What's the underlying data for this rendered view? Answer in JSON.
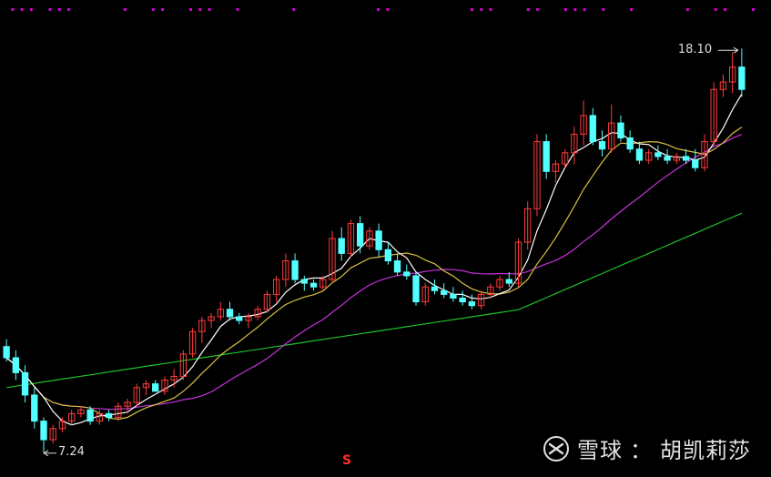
{
  "chart_data": {
    "type": "candlestick",
    "price_range": [
      6.6,
      19.4
    ],
    "high_label": "18.10",
    "low_label": "7.24",
    "signal_mark": "S",
    "colors": {
      "up": "#ff3b3b",
      "down": "#54ffff",
      "ma5": "#ffffff",
      "ma10": "#d6c242",
      "ma20": "#c433d8",
      "ma60": "#1fbf2a",
      "marker": "#d400d4",
      "grid": "#2a0000"
    },
    "candles": [
      [
        10.1,
        10.3,
        9.7,
        9.8
      ],
      [
        9.8,
        10.0,
        9.2,
        9.4
      ],
      [
        9.4,
        9.6,
        8.6,
        8.8
      ],
      [
        8.8,
        9.0,
        7.9,
        8.1
      ],
      [
        8.1,
        8.2,
        7.24,
        7.6
      ],
      [
        7.6,
        8.0,
        7.5,
        7.9
      ],
      [
        7.9,
        8.2,
        7.8,
        8.1
      ],
      [
        8.1,
        8.4,
        8.0,
        8.3
      ],
      [
        8.3,
        8.5,
        8.2,
        8.4
      ],
      [
        8.4,
        8.5,
        8.0,
        8.1
      ],
      [
        8.1,
        8.4,
        8.0,
        8.3
      ],
      [
        8.3,
        8.4,
        8.1,
        8.2
      ],
      [
        8.2,
        8.6,
        8.1,
        8.5
      ],
      [
        8.5,
        8.7,
        8.3,
        8.6
      ],
      [
        8.6,
        9.1,
        8.5,
        9.0
      ],
      [
        9.0,
        9.2,
        8.8,
        9.1
      ],
      [
        9.1,
        9.2,
        8.9,
        8.9
      ],
      [
        8.9,
        9.3,
        8.8,
        9.2
      ],
      [
        9.2,
        9.5,
        9.0,
        9.3
      ],
      [
        9.3,
        10.0,
        9.2,
        9.9
      ],
      [
        9.9,
        10.6,
        9.8,
        10.5
      ],
      [
        10.5,
        10.9,
        10.2,
        10.8
      ],
      [
        10.8,
        11.0,
        10.6,
        10.9
      ],
      [
        10.9,
        11.3,
        10.8,
        11.1
      ],
      [
        11.1,
        11.3,
        10.8,
        10.9
      ],
      [
        10.9,
        11.0,
        10.7,
        10.8
      ],
      [
        10.8,
        11.0,
        10.6,
        10.9
      ],
      [
        10.9,
        11.2,
        10.8,
        11.1
      ],
      [
        11.1,
        11.6,
        11.0,
        11.5
      ],
      [
        11.5,
        12.0,
        11.3,
        11.9
      ],
      [
        11.9,
        12.6,
        11.7,
        12.4
      ],
      [
        12.4,
        12.6,
        11.8,
        11.9
      ],
      [
        11.9,
        12.0,
        11.6,
        11.8
      ],
      [
        11.8,
        11.9,
        11.6,
        11.7
      ],
      [
        11.7,
        12.0,
        11.6,
        11.9
      ],
      [
        11.9,
        13.2,
        11.8,
        13.0
      ],
      [
        13.0,
        13.3,
        12.4,
        12.6
      ],
      [
        12.6,
        13.5,
        12.5,
        13.4
      ],
      [
        13.4,
        13.6,
        12.6,
        12.8
      ],
      [
        12.8,
        13.3,
        12.7,
        13.2
      ],
      [
        13.2,
        13.4,
        12.5,
        12.7
      ],
      [
        12.7,
        12.9,
        12.3,
        12.4
      ],
      [
        12.4,
        12.6,
        12.0,
        12.1
      ],
      [
        12.1,
        12.3,
        11.9,
        12.0
      ],
      [
        12.0,
        12.1,
        11.2,
        11.3
      ],
      [
        11.3,
        11.8,
        11.2,
        11.7
      ],
      [
        11.7,
        11.9,
        11.5,
        11.6
      ],
      [
        11.6,
        11.8,
        11.4,
        11.5
      ],
      [
        11.5,
        11.7,
        11.3,
        11.4
      ],
      [
        11.4,
        11.6,
        11.2,
        11.3
      ],
      [
        11.3,
        11.5,
        11.1,
        11.2
      ],
      [
        11.2,
        11.6,
        11.1,
        11.5
      ],
      [
        11.5,
        11.8,
        11.4,
        11.7
      ],
      [
        11.7,
        12.0,
        11.6,
        11.9
      ],
      [
        11.9,
        12.1,
        11.7,
        11.8
      ],
      [
        11.8,
        13.0,
        11.7,
        12.9
      ],
      [
        12.9,
        14.0,
        12.7,
        13.8
      ],
      [
        13.8,
        15.8,
        13.6,
        15.6
      ],
      [
        15.6,
        15.8,
        14.6,
        14.8
      ],
      [
        14.8,
        15.1,
        14.5,
        15.0
      ],
      [
        15.0,
        15.4,
        14.9,
        15.3
      ],
      [
        15.3,
        16.0,
        15.0,
        15.8
      ],
      [
        15.8,
        16.7,
        15.5,
        16.3
      ],
      [
        16.3,
        16.5,
        15.5,
        15.6
      ],
      [
        15.6,
        15.9,
        15.2,
        15.4
      ],
      [
        15.4,
        16.6,
        15.3,
        16.1
      ],
      [
        16.1,
        16.3,
        15.6,
        15.7
      ],
      [
        15.7,
        15.9,
        15.3,
        15.4
      ],
      [
        15.4,
        15.6,
        15.0,
        15.1
      ],
      [
        15.1,
        15.4,
        15.0,
        15.3
      ],
      [
        15.3,
        15.5,
        15.1,
        15.2
      ],
      [
        15.2,
        15.4,
        15.0,
        15.1
      ],
      [
        15.1,
        15.3,
        15.0,
        15.2
      ],
      [
        15.2,
        15.4,
        15.0,
        15.1
      ],
      [
        15.1,
        15.4,
        14.8,
        14.9
      ],
      [
        14.9,
        15.8,
        14.8,
        15.6
      ],
      [
        15.6,
        17.2,
        15.5,
        17.0
      ],
      [
        17.0,
        17.4,
        16.8,
        17.2
      ],
      [
        17.2,
        18.0,
        16.9,
        17.6
      ],
      [
        17.6,
        18.1,
        16.8,
        17.0
      ]
    ]
  },
  "watermark": {
    "brand": "雪球",
    "separator": "：",
    "author": "胡凯莉莎"
  }
}
